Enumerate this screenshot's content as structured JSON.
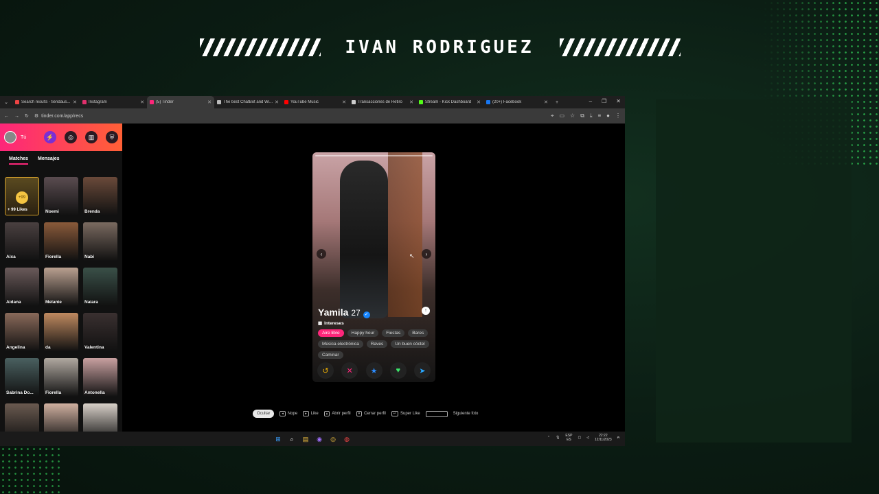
{
  "banner": {
    "title": "IVAN RODRIGUEZ"
  },
  "browser": {
    "tabs": [
      {
        "label": "Search results - tiendaus...",
        "color": "#e44"
      },
      {
        "label": "Instagram",
        "color": "#e1306c"
      },
      {
        "label": "(5) Tinder",
        "color": "#fd267a",
        "active": true
      },
      {
        "label": "The best ChatBot and Wi...",
        "color": "#bbb"
      },
      {
        "label": "YouTube Music",
        "color": "#f00"
      },
      {
        "label": "Transacciones de Retiro",
        "color": "#ccc"
      },
      {
        "label": "Stream - Kick Dashboard",
        "color": "#53fc18"
      },
      {
        "label": "(20+) Facebook",
        "color": "#1877f2"
      }
    ],
    "url": "tinder.com/app/recs"
  },
  "sidebar": {
    "user_label": "Tú",
    "tabs": {
      "matches": "Matches",
      "messages": "Mensajes"
    },
    "likes": {
      "count": "+99",
      "label": "+ 99 Likes"
    },
    "matches": [
      {
        "name": "Noemi",
        "color": "#5a4c50"
      },
      {
        "name": "Brenda",
        "color": "#6a4a3a"
      },
      {
        "name": "Aixa",
        "color": "#4a4040"
      },
      {
        "name": "Fiorella",
        "color": "#8a5a3a"
      },
      {
        "name": "Nabi",
        "color": "#7a6a60"
      },
      {
        "name": "Aidana",
        "color": "#6a5a5a"
      },
      {
        "name": "Melanie",
        "color": "#b9a090"
      },
      {
        "name": "Naiara",
        "color": "#3a5048"
      },
      {
        "name": "Angelina",
        "color": "#8a6a5a"
      },
      {
        "name": "da",
        "color": "#c08a60"
      },
      {
        "name": "Valentina",
        "color": "#3a3030"
      },
      {
        "name": "Sabrina Do...",
        "color": "#4a6060"
      },
      {
        "name": "Fiorella",
        "color": "#b0a8a0"
      },
      {
        "name": "Antonella",
        "color": "#c8a0a0"
      },
      {
        "name": "",
        "color": "#6a5a50"
      },
      {
        "name": "",
        "color": "#d0b0a0"
      },
      {
        "name": "",
        "color": "#d8d0c8"
      }
    ]
  },
  "card": {
    "name": "Yamila",
    "age": "27",
    "interests_label": "Intereses",
    "interests": [
      "Aire libre",
      "Happy hour",
      "Fiestas",
      "Bares",
      "Música electrónica",
      "Raves",
      "Un buen cóctel",
      "Caminar"
    ]
  },
  "shortcuts": {
    "hide": "Ocultar",
    "nope": "Nope",
    "like": "Like",
    "open_profile": "Abrir perfil",
    "close_profile": "Cerrar perfil",
    "super_like": "Super Like",
    "next_photo": "Siguiente foto"
  },
  "tray": {
    "lang": "ESP",
    "region": "ES",
    "time": "22:22",
    "date": "12/11/2023"
  }
}
